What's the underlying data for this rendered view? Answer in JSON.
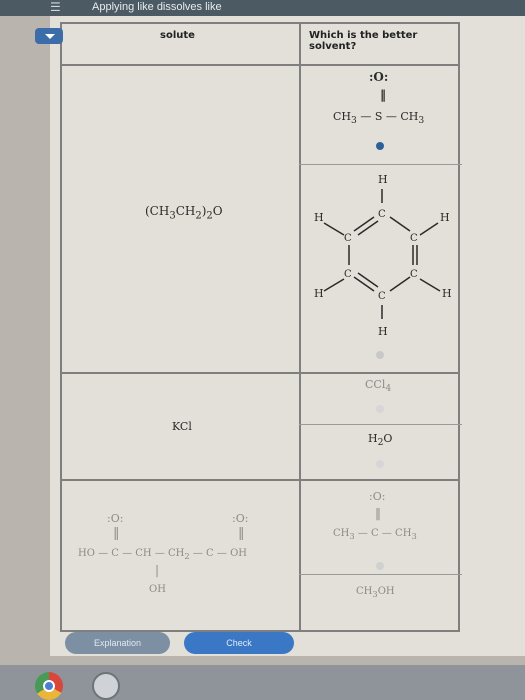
{
  "app_title": "Applying like dissolves like",
  "table": {
    "col_solute": "solute",
    "col_solvent": "Which is the better solvent?"
  },
  "rows": [
    {
      "solute": "(CH3CH2)2O",
      "options": [
        {
          "formula": "CH3 — S — CH3",
          "top": ":O:",
          "selected": true
        },
        {
          "formula": "benzene C6H6",
          "selected": false
        }
      ]
    },
    {
      "solute": "KCl",
      "options": [
        {
          "formula": "CCl4",
          "selected": false
        },
        {
          "formula": "H2O",
          "selected": false
        }
      ]
    },
    {
      "solute": "HO — C — CH — CH2 — C — OH",
      "solute_sub": "OH",
      "options": [
        {
          "formula": "CH3 — C — CH3",
          "top": ":O:",
          "selected": false
        },
        {
          "formula": "CH3OH",
          "selected": false
        }
      ]
    }
  ],
  "buttons": {
    "explanation": "Explanation",
    "check": "Check"
  },
  "colors": {
    "accent": "#3d6da8",
    "button_blue": "#3a78c6",
    "button_gray": "#7c8fa3"
  }
}
